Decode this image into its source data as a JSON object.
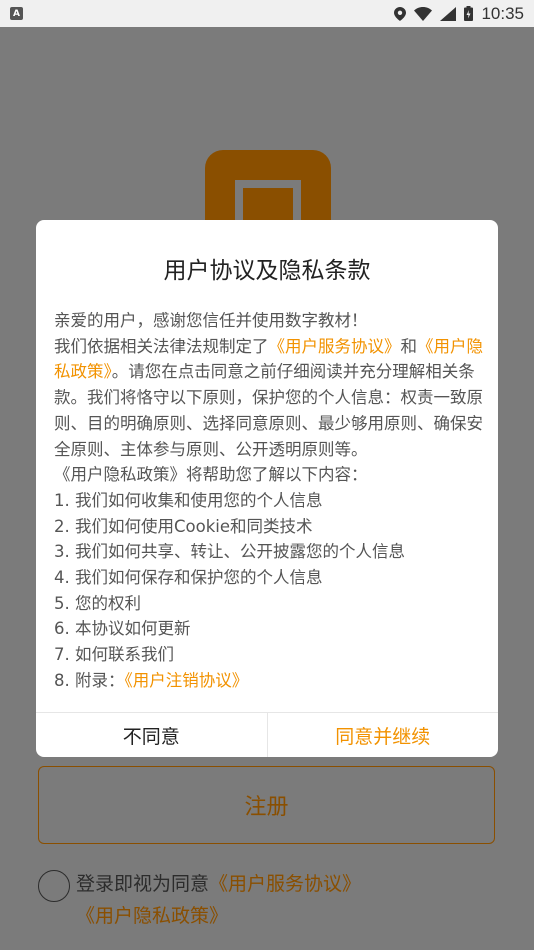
{
  "status_bar": {
    "left_icon": "A",
    "time": "10:35",
    "icons": [
      "location-icon",
      "wifi-icon",
      "signal-icon",
      "battery-icon"
    ]
  },
  "background": {
    "register_label": "注册",
    "consent_prefix": "登录即视为同意",
    "consent_link1": "《用户服务协议》",
    "consent_link2": "《用户隐私政策》"
  },
  "dialog": {
    "title": "用户协议及隐私条款",
    "greeting": "亲爱的用户，感谢您信任并使用数字教材！",
    "intro_prefix": "我们依据相关法律法规制定了",
    "link_service": "《用户服务协议》",
    "and": "和",
    "link_privacy": "《用户隐私政策》",
    "intro_suffix": "。请您在点击同意之前仔细阅读并充分理解相关条款。我们将恪守以下原则，保护您的个人信息：权责一致原则、目的明确原则、选择同意原则、最少够用原则、确保安全原则、主体参与原则、公开透明原则等。",
    "help_line": "《用户隐私政策》将帮助您了解以下内容：",
    "items": [
      "1. 我们如何收集和使用您的个人信息",
      "2. 我们如何使用Cookie和同类技术",
      "3. 我们如何共享、转让、公开披露您的个人信息",
      "4. 我们如何保存和保护您的个人信息",
      "5. 您的权利",
      "6. 本协议如何更新",
      "7. 如何联系我们"
    ],
    "item8_prefix": "8. 附录：",
    "item8_link": "《用户注销协议》",
    "disagree_label": "不同意",
    "agree_label": "同意并继续"
  },
  "colors": {
    "accent": "#f29200",
    "overlay_bg": "#7b7b7b",
    "dim_accent": "#8a4f00"
  }
}
